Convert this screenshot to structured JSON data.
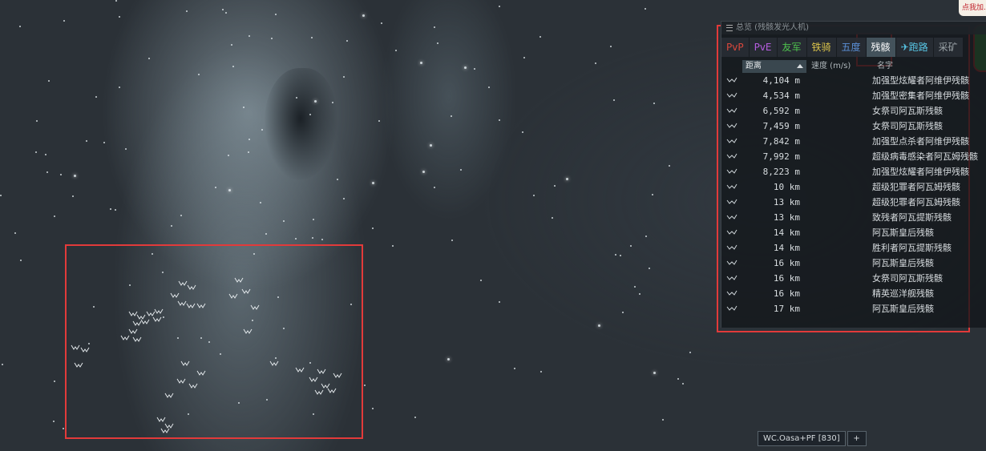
{
  "overview": {
    "title": "总览 (残骸发光人机)",
    "tabs": [
      {
        "label": "PvP",
        "color": "#d9473c"
      },
      {
        "label": "PvE",
        "color": "#b55de0"
      },
      {
        "label": "友军",
        "color": "#4ec24e"
      },
      {
        "label": "铁骑",
        "color": "#d9c24a"
      },
      {
        "label": "五度",
        "color": "#5a8fd6"
      },
      {
        "label": "残骸",
        "color": "#ffffff"
      },
      {
        "label": "✈跑路",
        "color": "#58c8e8"
      },
      {
        "label": "采矿",
        "color": "#9aa2a6"
      }
    ],
    "active_tab": "残骸",
    "columns": {
      "distance": "距离",
      "speed": "速度 (m/s)",
      "name": "名字"
    },
    "rows": [
      {
        "distance": "4,104 m",
        "speed": "",
        "name": "加强型炫耀者阿维伊残骸"
      },
      {
        "distance": "4,534 m",
        "speed": "",
        "name": "加强型密集者阿维伊残骸"
      },
      {
        "distance": "6,592 m",
        "speed": "",
        "name": "女祭司阿瓦斯残骸"
      },
      {
        "distance": "7,459 m",
        "speed": "",
        "name": "女祭司阿瓦斯残骸"
      },
      {
        "distance": "7,842 m",
        "speed": "",
        "name": "加强型点杀者阿维伊残骸"
      },
      {
        "distance": "7,992 m",
        "speed": "",
        "name": "超级病毒感染者阿瓦姆残骸"
      },
      {
        "distance": "8,223 m",
        "speed": "",
        "name": "加强型炫耀者阿维伊残骸"
      },
      {
        "distance": "10 km",
        "speed": "",
        "name": "超级犯罪者阿瓦姆残骸"
      },
      {
        "distance": "13 km",
        "speed": "",
        "name": "超级犯罪者阿瓦姆残骸"
      },
      {
        "distance": "13 km",
        "speed": "",
        "name": "致残者阿瓦提斯残骸"
      },
      {
        "distance": "14 km",
        "speed": "",
        "name": "阿瓦斯皇后残骸"
      },
      {
        "distance": "14 km",
        "speed": "",
        "name": "胜利者阿瓦提斯残骸"
      },
      {
        "distance": "16 km",
        "speed": "",
        "name": "阿瓦斯皇后残骸"
      },
      {
        "distance": "16 km",
        "speed": "",
        "name": "女祭司阿瓦斯残骸"
      },
      {
        "distance": "16 km",
        "speed": "",
        "name": "精英巡洋舰残骸"
      },
      {
        "distance": "17 km",
        "speed": "",
        "name": "阿瓦斯皇后残骸"
      }
    ]
  },
  "promo": {
    "label": "点我加..."
  },
  "bottom_bar": {
    "fleet_tab": "WC.Oasa+PF [830]",
    "add_label": "+"
  }
}
